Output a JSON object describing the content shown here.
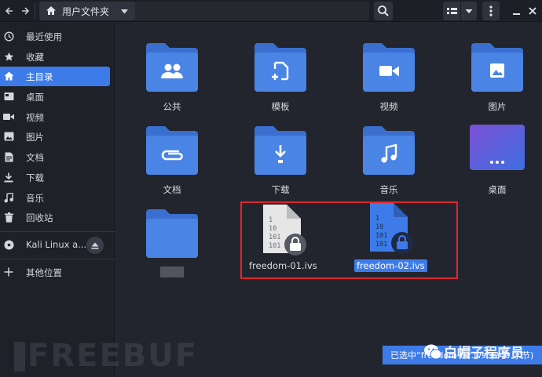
{
  "header": {
    "path_label": "用户文件夹"
  },
  "sidebar": {
    "items": [
      {
        "label": "最近使用",
        "icon": "clock-icon"
      },
      {
        "label": "收藏",
        "icon": "star-icon"
      },
      {
        "label": "主目录",
        "icon": "home-icon",
        "active": true
      },
      {
        "label": "桌面",
        "icon": "desktop-icon"
      },
      {
        "label": "视频",
        "icon": "video-icon"
      },
      {
        "label": "图片",
        "icon": "image-icon"
      },
      {
        "label": "文档",
        "icon": "document-icon"
      },
      {
        "label": "下载",
        "icon": "download-icon"
      },
      {
        "label": "音乐",
        "icon": "music-icon"
      },
      {
        "label": "回收站",
        "icon": "trash-icon"
      }
    ],
    "devices": [
      {
        "label": "Kali Linux a...",
        "icon": "disc-icon"
      }
    ],
    "other": {
      "label": "其他位置",
      "icon": "plus-icon"
    }
  },
  "folders": [
    {
      "label": "公共",
      "icon": "people-icon"
    },
    {
      "label": "模板",
      "icon": "template-icon"
    },
    {
      "label": "视频",
      "icon": "video-icon"
    },
    {
      "label": "图片",
      "icon": "image-icon"
    },
    {
      "label": "文档",
      "icon": "paperclip-icon"
    },
    {
      "label": "下载",
      "icon": "download-icon"
    },
    {
      "label": "音乐",
      "icon": "music-icon"
    },
    {
      "label": "桌面",
      "icon": "dots-icon"
    }
  ],
  "files": [
    {
      "name": "freedom-01.ivs",
      "icon": "locked-binary-file-icon",
      "selected": false
    },
    {
      "name": "freedom-02.ivs",
      "icon": "locked-binary-file-icon",
      "selected": true
    }
  ],
  "status": {
    "text": "已选中“freedom-02.ivs”(240 字节)"
  },
  "watermark": {
    "text": "白帽子程序员",
    "brand": "FREEBUF"
  },
  "colors": {
    "accent": "#3d7ce8",
    "folder": "#4a84e4",
    "selection_box": "#e0262b"
  }
}
